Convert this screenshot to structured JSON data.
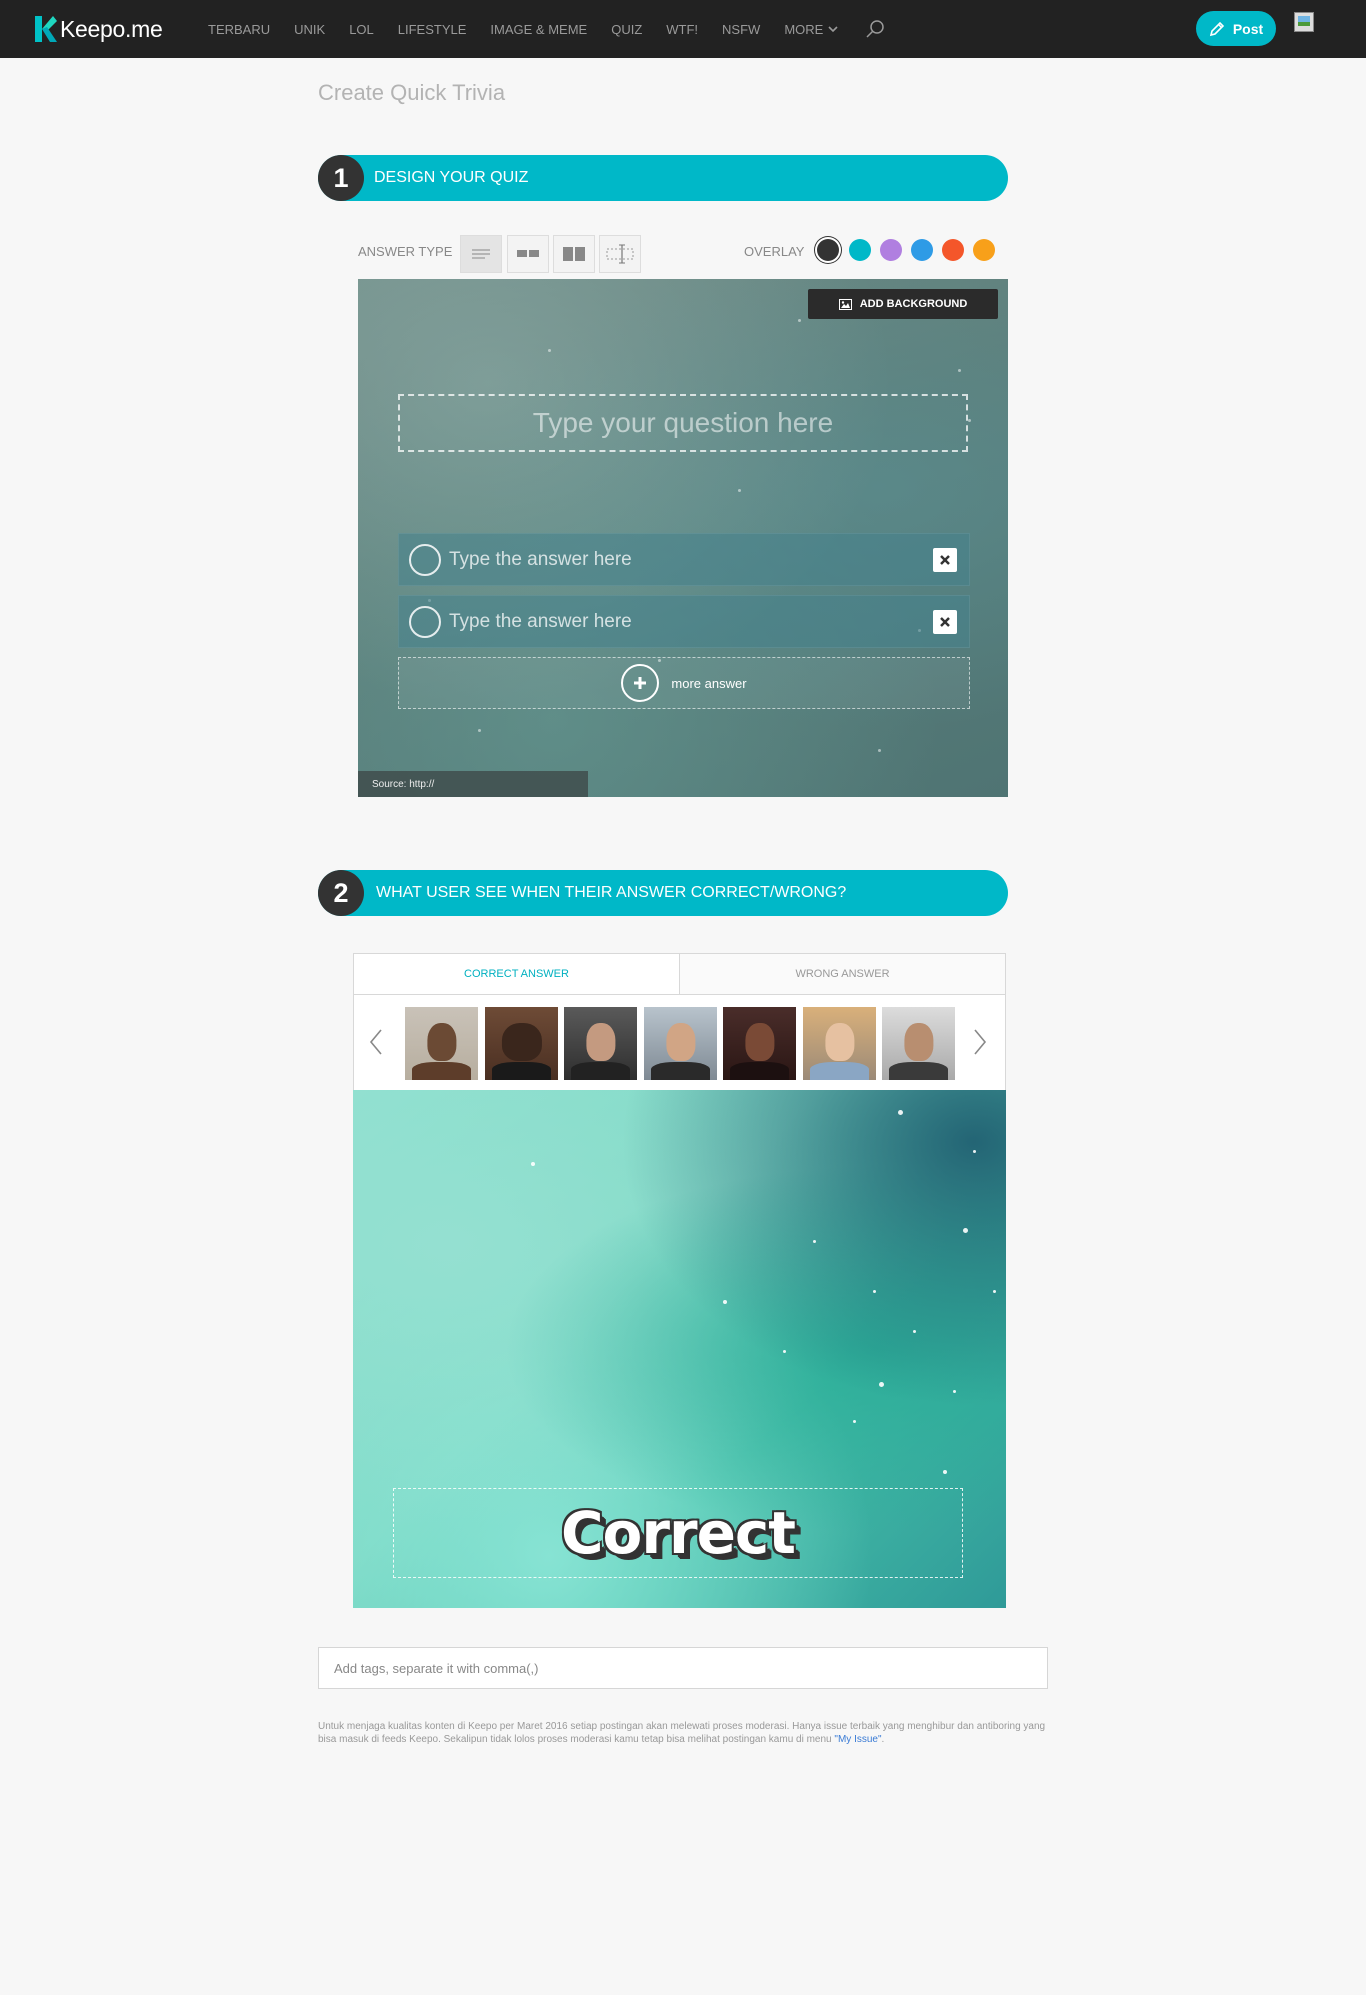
{
  "brand": {
    "name": "Keepo.me",
    "accent": "#00b8c8"
  },
  "nav": {
    "links": [
      "TERBARU",
      "UNIK",
      "LOL",
      "LIFESTYLE",
      "IMAGE & MEME",
      "QUIZ",
      "WTF!",
      "NSFW"
    ],
    "more_label": "MORE",
    "post_label": "Post"
  },
  "page": {
    "title": "Create Quick Trivia"
  },
  "section1": {
    "number": "1",
    "title": "DESIGN YOUR QUIZ",
    "answer_type_label": "ANSWER TYPE",
    "overlay_label": "OVERLAY",
    "overlay_colors": [
      "#333333",
      "#00b8c8",
      "#b07fe0",
      "#2e9be6",
      "#f4562a",
      "#f8a01a"
    ],
    "add_background_label": "ADD BACKGROUND",
    "question_placeholder": "Type your question here",
    "answers": [
      {
        "placeholder": "Type the answer here"
      },
      {
        "placeholder": "Type the answer here"
      }
    ],
    "more_answer_label": "more answer",
    "source_label": "Source: http://"
  },
  "section2": {
    "number": "2",
    "title": "WHAT USER SEE WHEN THEIR ANSWER CORRECT/WRONG?",
    "tabs": {
      "correct": "CORRECT ANSWER",
      "wrong": "WRONG ANSWER"
    },
    "result_text": "Correct"
  },
  "tags": {
    "placeholder": "Add tags, separate it with comma(,)"
  },
  "notice": {
    "text": "Untuk menjaga kualitas konten di Keepo per Maret 2016 setiap postingan akan melewati proses moderasi. Hanya issue terbaik yang menghibur dan antiboring yang bisa masuk di feeds Keepo. Sekalipun tidak lolos proses moderasi kamu tetap bisa melihat postingan kamu di menu ",
    "link_text": "\"My Issue\"",
    "end": "."
  }
}
